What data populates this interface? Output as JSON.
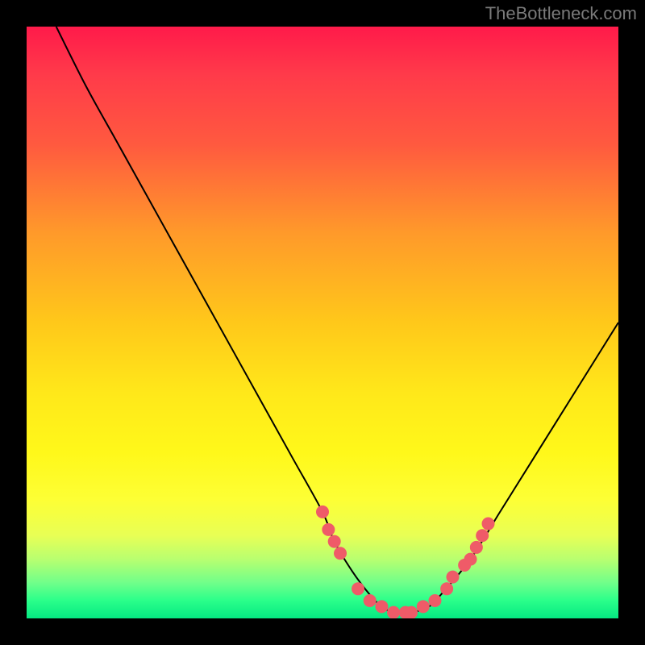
{
  "watermark": "TheBottleneck.com",
  "chart_data": {
    "type": "line",
    "title": "",
    "xlabel": "",
    "ylabel": "",
    "xlim": [
      0,
      100
    ],
    "ylim": [
      0,
      100
    ],
    "series": [
      {
        "name": "bottleneck-curve",
        "x": [
          5,
          10,
          15,
          20,
          25,
          30,
          35,
          40,
          45,
          50,
          52,
          55,
          58,
          60,
          62,
          65,
          68,
          70,
          75,
          80,
          85,
          90,
          95,
          100
        ],
        "y": [
          100,
          90,
          81,
          72,
          63,
          54,
          45,
          36,
          27,
          18,
          13,
          8,
          4,
          2,
          1,
          1,
          2,
          4,
          10,
          18,
          26,
          34,
          42,
          50
        ]
      }
    ],
    "markers": [
      {
        "x": 50,
        "y": 18
      },
      {
        "x": 51,
        "y": 15
      },
      {
        "x": 52,
        "y": 13
      },
      {
        "x": 53,
        "y": 11
      },
      {
        "x": 56,
        "y": 5
      },
      {
        "x": 58,
        "y": 3
      },
      {
        "x": 60,
        "y": 2
      },
      {
        "x": 62,
        "y": 1
      },
      {
        "x": 64,
        "y": 1
      },
      {
        "x": 65,
        "y": 1
      },
      {
        "x": 67,
        "y": 2
      },
      {
        "x": 69,
        "y": 3
      },
      {
        "x": 71,
        "y": 5
      },
      {
        "x": 72,
        "y": 7
      },
      {
        "x": 74,
        "y": 9
      },
      {
        "x": 75,
        "y": 10
      },
      {
        "x": 76,
        "y": 12
      },
      {
        "x": 77,
        "y": 14
      },
      {
        "x": 78,
        "y": 16
      }
    ],
    "colors": {
      "curve": "#000000",
      "marker": "#ef5b68"
    }
  }
}
